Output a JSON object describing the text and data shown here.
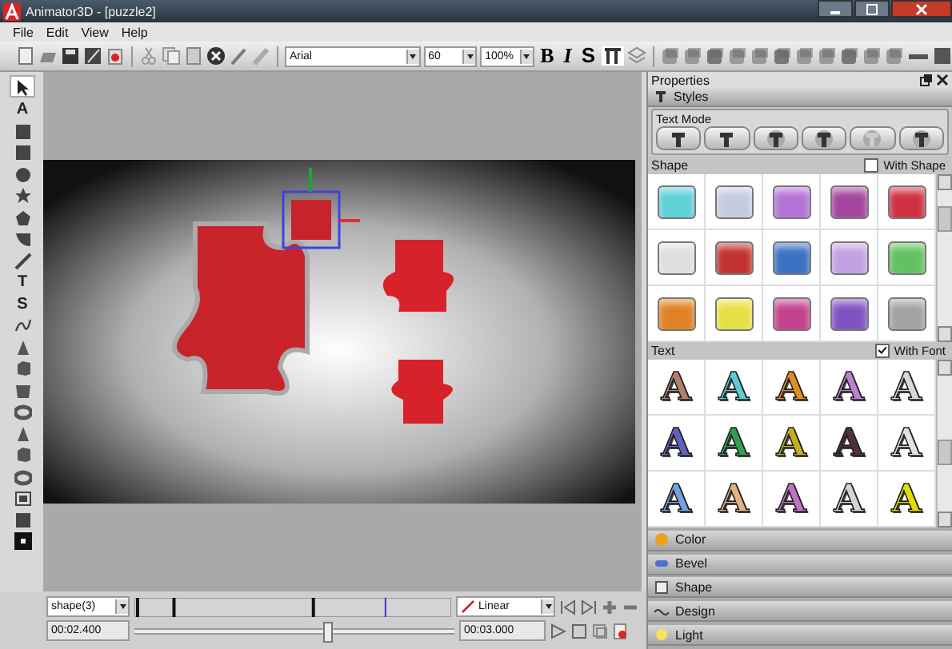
{
  "window": {
    "title": "Animator3D - [puzzle2]"
  },
  "menu": [
    "File",
    "Edit",
    "View",
    "Help"
  ],
  "toolbar": {
    "font": "Arial",
    "size": "60",
    "zoom": "100%",
    "format_buttons": [
      {
        "label": "B",
        "kind": "bold"
      },
      {
        "label": "I",
        "kind": "italic"
      },
      {
        "label": "S",
        "kind": "plain"
      }
    ]
  },
  "tools": [
    {
      "kind": "pointer",
      "selected": true
    },
    {
      "kind": "letter",
      "label": "A",
      "selected": false
    },
    {
      "kind": "square",
      "selected": false
    },
    {
      "kind": "square",
      "selected": false
    },
    {
      "kind": "circle",
      "selected": false
    },
    {
      "kind": "star",
      "selected": false
    },
    {
      "kind": "pentagon",
      "selected": false
    },
    {
      "kind": "wedge",
      "selected": false
    },
    {
      "kind": "line",
      "selected": false
    },
    {
      "kind": "letter",
      "label": "T",
      "selected": false
    },
    {
      "kind": "letter",
      "label": "S",
      "selected": false
    },
    {
      "kind": "curve",
      "selected": false
    },
    {
      "kind": "cone",
      "selected": false
    },
    {
      "kind": "cube",
      "selected": false
    },
    {
      "kind": "cup",
      "selected": false
    },
    {
      "kind": "torus",
      "selected": false
    },
    {
      "kind": "cone",
      "selected": false
    },
    {
      "kind": "cube",
      "selected": false
    },
    {
      "kind": "torus",
      "selected": false
    },
    {
      "kind": "image",
      "selected": false
    },
    {
      "kind": "square",
      "selected": false
    },
    {
      "kind": "dark",
      "selected": false
    }
  ],
  "properties": {
    "title": "Properties",
    "styles": "Styles",
    "text_mode": {
      "label": "Text Mode"
    },
    "shape_section": {
      "label": "Shape",
      "option": "With Shape",
      "checked": false,
      "swatches": [
        {
          "color": "#5fcfd8"
        },
        {
          "color": "#c4cce0"
        },
        {
          "color": "#b272d6"
        },
        {
          "color": "#a2459e"
        },
        {
          "color": "#cf3140"
        },
        {
          "color": "#dedede"
        },
        {
          "color": "#c23232"
        },
        {
          "color": "#3a72c2"
        },
        {
          "color": "#c2a2e2"
        },
        {
          "color": "#62c262"
        },
        {
          "color": "#e08224"
        },
        {
          "color": "#e6e044"
        },
        {
          "color": "#c24290"
        },
        {
          "color": "#8252c2"
        },
        {
          "color": "#a2a2a2"
        }
      ]
    },
    "text_section": {
      "label": "Text",
      "option": "With Font",
      "checked": true,
      "letters": [
        {
          "label": "A",
          "color": "#b08070"
        },
        {
          "label": "A",
          "color": "#5ccccc"
        },
        {
          "label": "A",
          "color": "#e09020"
        },
        {
          "label": "A",
          "color": "#c080d0"
        },
        {
          "label": "A",
          "color": "#d8d8d8"
        },
        {
          "label": "A",
          "color": "#6262c2"
        },
        {
          "label": "A",
          "color": "#30a050"
        },
        {
          "label": "A",
          "color": "#c2b020"
        },
        {
          "label": "A",
          "color": "#503040"
        },
        {
          "label": "A",
          "color": "#e2e2e2"
        },
        {
          "label": "A",
          "color": "#72a2e2"
        },
        {
          "label": "A",
          "color": "#e2b282"
        },
        {
          "label": "A",
          "color": "#c272c2"
        },
        {
          "label": "A",
          "color": "#d4d4d4"
        },
        {
          "label": "A",
          "color": "#e0e000"
        }
      ]
    },
    "sections": [
      {
        "label": "Color",
        "kind": "color"
      },
      {
        "label": "Bevel",
        "kind": "bevel"
      },
      {
        "label": "Shape",
        "kind": "shape"
      },
      {
        "label": "Design",
        "kind": "design"
      },
      {
        "label": "Light",
        "kind": "light"
      }
    ]
  },
  "timeline": {
    "object": "shape(3)",
    "interpolation": "Linear",
    "current_time": "00:02.400",
    "end_time": "00:03.000",
    "scrubber": {
      "level": 0.6
    }
  }
}
